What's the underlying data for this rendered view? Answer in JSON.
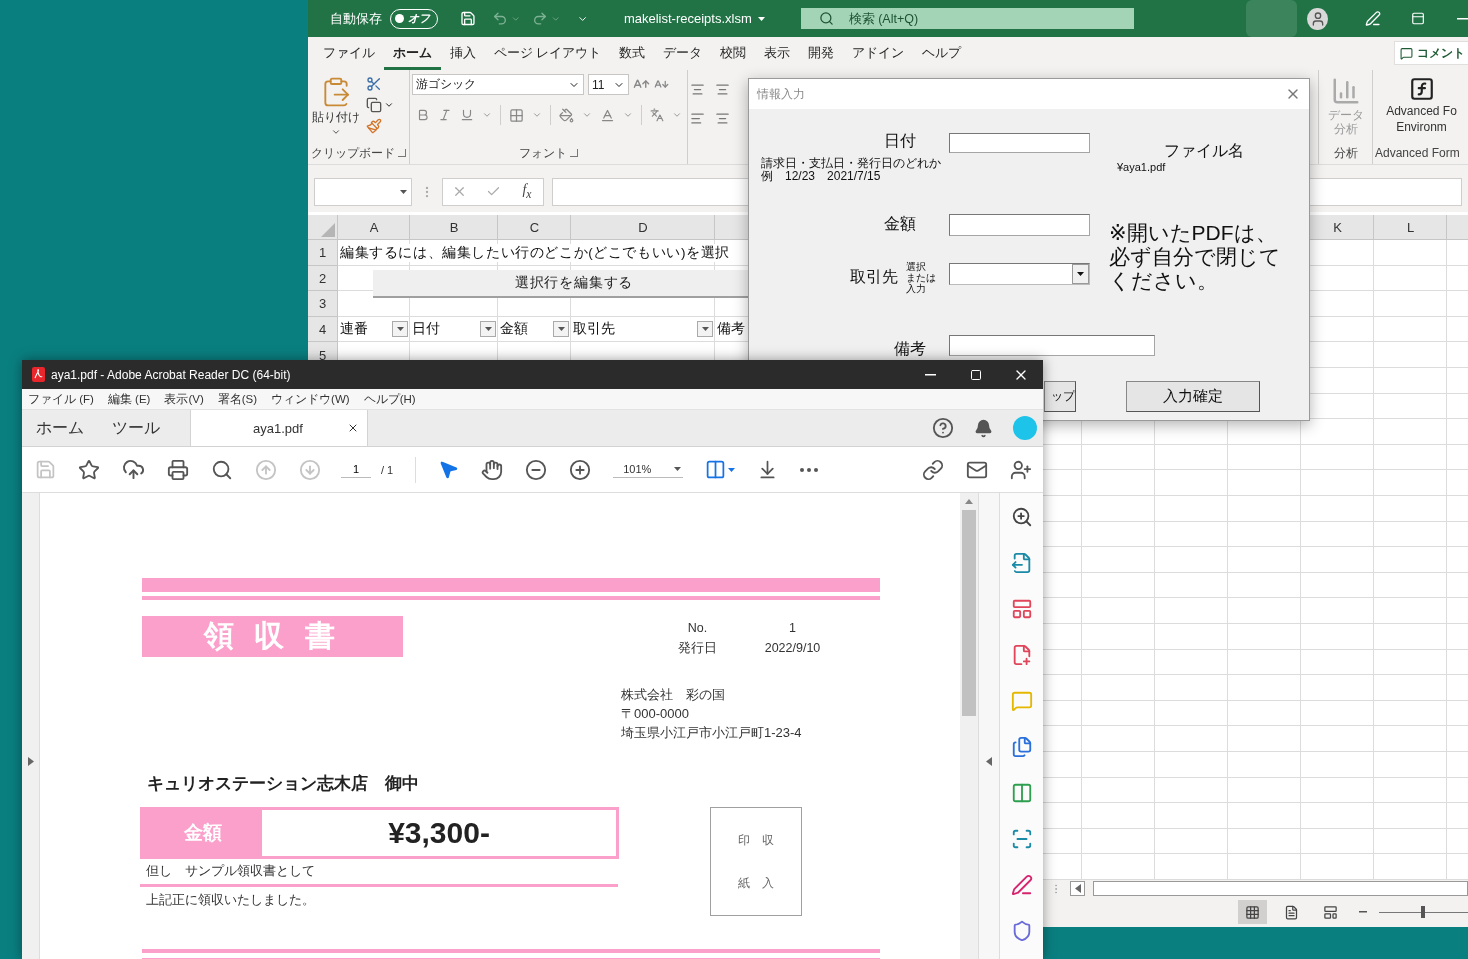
{
  "excel": {
    "title_bar": {
      "autosave_label": "自動保存",
      "autosave": {
        "label": "オフ",
        "on": false
      },
      "filename": "makelist-receipts.xlsm",
      "search_placeholder": "検索 (Alt+Q)"
    },
    "ribbon_tabs": [
      {
        "label": "ファイル",
        "selected": false
      },
      {
        "label": "ホーム",
        "selected": true
      },
      {
        "label": "挿入",
        "selected": false
      },
      {
        "label": "ページ レイアウト",
        "selected": false
      },
      {
        "label": "数式",
        "selected": false
      },
      {
        "label": "データ",
        "selected": false
      },
      {
        "label": "校閲",
        "selected": false
      },
      {
        "label": "表示",
        "selected": false
      },
      {
        "label": "開発",
        "selected": false
      },
      {
        "label": "アドイン",
        "selected": false
      },
      {
        "label": "ヘルプ",
        "selected": false
      }
    ],
    "comment_button": "コメント",
    "clipboard_group": {
      "paste_label": "貼り付け",
      "name": "クリップボード"
    },
    "font_group": {
      "font_name": "游ゴシック",
      "font_size": "11",
      "name": "フォント"
    },
    "analysis_group": {
      "button": "データ分析",
      "name": "分析"
    },
    "advanced_group": {
      "button_lines": [
        "Advanced Fo",
        "Environm"
      ],
      "name": "Advanced Form"
    },
    "formula_bar": {
      "function_label": "f$_{x}$"
    },
    "sheet": {
      "columns_left": [
        "A",
        "B",
        "C",
        "D"
      ],
      "columns_right": [
        "K",
        "L"
      ],
      "row_numbers": [
        "1",
        "2",
        "3",
        "4",
        "5"
      ],
      "note": "編集するには、編集したい行のどこか(どこでもいい)を選択",
      "edit_button": "選択行を編集する",
      "table_headers": [
        "連番",
        "日付",
        "金額",
        "取引先",
        "備考"
      ]
    },
    "view_buttons": [
      {
        "selected": true
      },
      {
        "selected": false
      },
      {
        "selected": false
      }
    ],
    "zoom_slider": {
      "level": 0.5
    }
  },
  "dialog": {
    "title": "情報入力",
    "date_label": "日付",
    "date_hint": [
      "請求日・支払日・発行日のどれか",
      "例　12/23　2021/7/15"
    ],
    "filename_label": "ファイル名",
    "filename": "¥aya1.pdf",
    "amount_label": "金額",
    "notice_lines": [
      "※開いたPDFは、",
      "必ず自分で閉じて",
      "ください。"
    ],
    "partner_label": "取引先",
    "partner_hint_lines": [
      "選択",
      "または",
      "入力"
    ],
    "memo_label": "備考",
    "buttons": [
      "ップ",
      "入力確定"
    ]
  },
  "acrobat": {
    "title": "aya1.pdf - Adobe Acrobat Reader DC (64-bit)",
    "menu": [
      "ファイル (F)",
      "編集 (E)",
      "表示(V)",
      "署名(S)",
      "ウィンドウ(W)",
      "ヘルプ(H)"
    ],
    "tabs": [
      {
        "kind": "nav",
        "label": "ホーム",
        "selected": false
      },
      {
        "kind": "nav",
        "label": "ツール",
        "selected": false
      },
      {
        "kind": "document",
        "label": "aya1.pdf",
        "selected": true
      }
    ],
    "toolbar": {
      "save": {
        "disabled": true
      },
      "previous_page": {
        "disabled": true
      },
      "next_page": {
        "disabled": true
      },
      "page_number": "1",
      "page_count": "/ 1",
      "select_tool": {
        "selected": true
      },
      "hand_tool": {
        "selected": false
      },
      "zoom": "101%"
    },
    "receipt": {
      "title": "領 収 書",
      "number_label": "No.",
      "number": "1",
      "date_label": "発行日",
      "date": "2022/9/10",
      "issuer_lines": [
        "株式会社　彩の国",
        "〒000-0000",
        "埼玉県小江戸市小江戸町1-23-4"
      ],
      "customer": "キュリオステーション志木店　御中",
      "amount_label": "金額",
      "amount": "¥3,300-",
      "purpose": "但し　サンプル領収書として",
      "acknowledgement": "上記正に領収いたしました。",
      "stamp_lines": [
        "印　収",
        "紙　入"
      ]
    }
  }
}
